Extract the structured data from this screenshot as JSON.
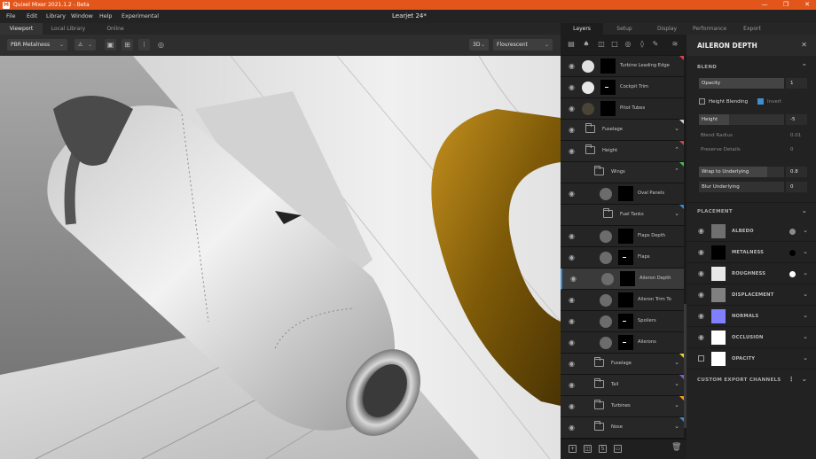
{
  "titlebar": {
    "title": "Quixel Mixer 2021.1.2 - Beta",
    "logo": "M",
    "controls": [
      "—",
      "❐",
      "✕"
    ]
  },
  "menu": {
    "items": [
      "File",
      "Edit",
      "Library",
      "Window",
      "Help",
      "Experimental"
    ],
    "document_title": "Learjet 24*"
  },
  "viewport_tabs": {
    "items": [
      "Viewport",
      "Local Library",
      "Online"
    ],
    "active": "Viewport"
  },
  "viewport_toolbar": {
    "material_mode": "PBR Metalness",
    "view_mode": "3D",
    "lighting": "Flourescent"
  },
  "right_tabs": {
    "items": [
      "Layers",
      "Setup",
      "Display",
      "Performance",
      "Export"
    ],
    "active": "Layers"
  },
  "layers": [
    {
      "name": "Turbine Leading Edge",
      "type": "layer",
      "indent": 0,
      "thumb_color": "#e0e0e0",
      "mask": "black",
      "flag": "#e0404a",
      "visible": true
    },
    {
      "name": "Cockpit Trim",
      "type": "layer",
      "indent": 0,
      "thumb_color": "#e8e8e8",
      "mask": "dot",
      "flag": "",
      "visible": true
    },
    {
      "name": "Pitot Tubes",
      "type": "layer",
      "indent": 0,
      "thumb_color": "#4a4436",
      "mask": "black",
      "flag": "",
      "visible": true
    },
    {
      "name": "Fuselage",
      "type": "folder",
      "indent": 0,
      "expanded": false,
      "flag": "#cfcfcf",
      "visible": true
    },
    {
      "name": "Height",
      "type": "folder",
      "indent": 0,
      "expanded": true,
      "flag": "#e0404a",
      "visible": true
    },
    {
      "name": "Wings",
      "type": "folder",
      "indent": 1,
      "expanded": true,
      "flag": "#48c040",
      "visible": false
    },
    {
      "name": "Oval Panels",
      "type": "layer",
      "indent": 2,
      "thumb_color": "#6c6c6c",
      "mask": "black",
      "flag": "",
      "visible": true
    },
    {
      "name": "Fuel Tanks",
      "type": "folder",
      "indent": 2,
      "expanded": false,
      "flag": "#2f8fe0",
      "visible": false
    },
    {
      "name": "Flaps Depth",
      "type": "layer",
      "indent": 2,
      "thumb_color": "#6c6c6c",
      "mask": "black",
      "flag": "",
      "visible": true
    },
    {
      "name": "Flaps",
      "type": "layer",
      "indent": 2,
      "thumb_color": "#6c6c6c",
      "mask": "dot",
      "flag": "",
      "visible": true
    },
    {
      "name": "Aileron Depth",
      "type": "layer",
      "indent": 2,
      "thumb_color": "#6c6c6c",
      "mask": "black",
      "flag": "",
      "visible": true,
      "selected": true
    },
    {
      "name": "Aileron Trim To",
      "type": "layer",
      "indent": 2,
      "thumb_color": "#6c6c6c",
      "mask": "black",
      "flag": "",
      "visible": true
    },
    {
      "name": "Spoilers",
      "type": "layer",
      "indent": 2,
      "thumb_color": "#6c6c6c",
      "mask": "dot",
      "flag": "",
      "visible": true
    },
    {
      "name": "Ailerons",
      "type": "layer",
      "indent": 2,
      "thumb_color": "#6c6c6c",
      "mask": "dot",
      "flag": "",
      "visible": true
    },
    {
      "name": "Fuselage",
      "type": "folder",
      "indent": 1,
      "expanded": false,
      "flag": "#f0d020",
      "visible": true
    },
    {
      "name": "Tail",
      "type": "folder",
      "indent": 1,
      "expanded": false,
      "flag": "#8a58e0",
      "visible": true
    },
    {
      "name": "Turbines",
      "type": "folder",
      "indent": 1,
      "expanded": false,
      "flag": "#f0a020",
      "visible": true
    },
    {
      "name": "Nose",
      "type": "folder",
      "indent": 1,
      "expanded": false,
      "flag": "#2f8fe0",
      "visible": true
    }
  ],
  "properties": {
    "title": "AILERON DEPTH",
    "blend": {
      "header": "BLEND",
      "opacity_label": "Opacity",
      "opacity_value": "1",
      "opacity_fill": 1.0,
      "height_blending_label": "Height Blending",
      "invert_label": "Invert",
      "invert_checked": true,
      "height_blending_checked": false,
      "height_label": "Height",
      "height_value": "-5",
      "height_fill": 0.35,
      "blend_radius_label": "Blend Radius",
      "blend_radius_value": "0.01",
      "preserve_details_label": "Preserve Details",
      "preserve_details_value": "0",
      "wrap_label": "Wrap to Underlying",
      "wrap_value": "0.8",
      "wrap_fill": 0.8,
      "blur_label": "Blur Underlying",
      "blur_value": "0"
    },
    "placement_header": "PLACEMENT",
    "channels": [
      {
        "name": "ALBEDO",
        "swatch": "#6f6f6f",
        "dot": "#8a8a8a",
        "toggle": "eye"
      },
      {
        "name": "METALNESS",
        "swatch": "#000000",
        "dot": "#000000",
        "toggle": "eye"
      },
      {
        "name": "ROUGHNESS",
        "swatch": "#e8e8e8",
        "dot": "#ffffff",
        "toggle": "eye"
      },
      {
        "name": "DISPLACEMENT",
        "swatch": "#808080",
        "dot": "",
        "toggle": "eye"
      },
      {
        "name": "NORMALS",
        "swatch": "#8080ff",
        "dot": "",
        "toggle": "eye"
      },
      {
        "name": "OCCLUSION",
        "swatch": "#ffffff",
        "dot": "",
        "toggle": "eye"
      },
      {
        "name": "OPACITY",
        "swatch": "#ffffff",
        "dot": "",
        "toggle": "checkbox"
      }
    ],
    "custom_export_header": "CUSTOM EXPORT CHANNELS"
  }
}
